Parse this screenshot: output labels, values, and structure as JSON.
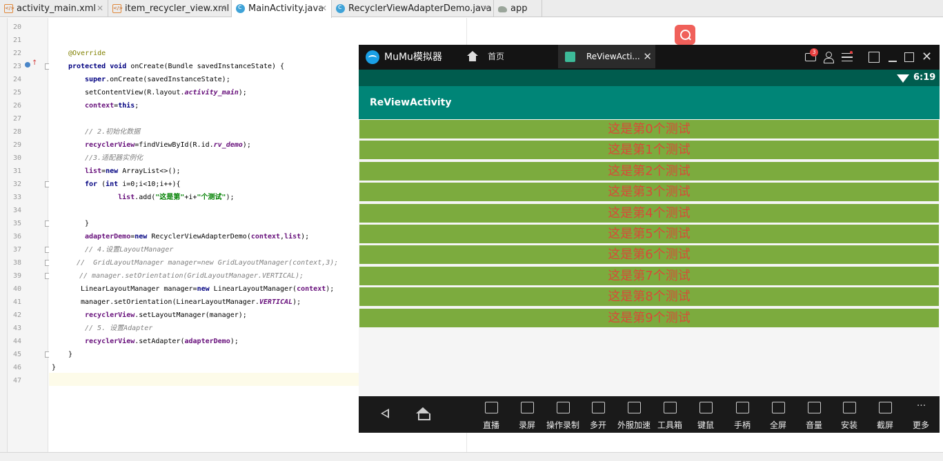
{
  "tabs": [
    {
      "label": "activity_main.xml",
      "icon": "xml-file-icon",
      "active": false
    },
    {
      "label": "item_recycler_view.xml",
      "icon": "xml-file-icon",
      "active": false
    },
    {
      "label": "MainActivity.java",
      "icon": "java-class-icon",
      "active": true
    },
    {
      "label": "RecyclerViewAdapterDemo.java",
      "icon": "java-class-icon",
      "active": false
    },
    {
      "label": "app",
      "icon": "gradle-icon",
      "active": false
    }
  ],
  "editor": {
    "line_numbers": [
      "20",
      "21",
      "22",
      "23",
      "24",
      "25",
      "26",
      "27",
      "28",
      "29",
      "30",
      "31",
      "32",
      "33",
      "34",
      "35",
      "36",
      "37",
      "38",
      "39",
      "40",
      "41",
      "42",
      "43",
      "44",
      "45",
      "46",
      "47"
    ],
    "code_lines": [
      [],
      [],
      [
        {
          "t": "@Override",
          "c": "an"
        }
      ],
      [
        {
          "t": "protected void ",
          "c": "kw"
        },
        {
          "t": "onCreate(Bundle savedInstanceState) {",
          "c": ""
        }
      ],
      [
        {
          "t": "super",
          "c": "kw"
        },
        {
          "t": ".onCreate(savedInstanceState);",
          "c": ""
        }
      ],
      [
        {
          "t": "setContentView(R.layout.",
          "c": ""
        },
        {
          "t": "activity_main",
          "c": "fi"
        },
        {
          "t": ");",
          "c": ""
        }
      ],
      [
        {
          "t": "context",
          "c": "fld"
        },
        {
          "t": "=",
          "c": ""
        },
        {
          "t": "this",
          "c": "kw"
        },
        {
          "t": ";",
          "c": ""
        }
      ],
      [],
      [
        {
          "t": "// 2.初始化数据",
          "c": "cm"
        }
      ],
      [
        {
          "t": "recyclerView",
          "c": "fld"
        },
        {
          "t": "=findViewById(R.id.",
          "c": ""
        },
        {
          "t": "rv_demo",
          "c": "fi"
        },
        {
          "t": ");",
          "c": ""
        }
      ],
      [
        {
          "t": "//3.适配器实例化",
          "c": "cm"
        }
      ],
      [
        {
          "t": "list",
          "c": "fld"
        },
        {
          "t": "=",
          "c": ""
        },
        {
          "t": "new ",
          "c": "kw"
        },
        {
          "t": "ArrayList<>();",
          "c": ""
        }
      ],
      [
        {
          "t": "for ",
          "c": "kw"
        },
        {
          "t": "(",
          "c": ""
        },
        {
          "t": "int ",
          "c": "kw"
        },
        {
          "t": "i=0;i<10;i++){",
          "c": ""
        }
      ],
      [
        {
          "t": "    list",
          "c": "fld"
        },
        {
          "t": ".add(",
          "c": ""
        },
        {
          "t": "\"这是第\"",
          "c": "st"
        },
        {
          "t": "+i+",
          "c": ""
        },
        {
          "t": "\"个测试\"",
          "c": "st"
        },
        {
          "t": ");",
          "c": ""
        }
      ],
      [],
      [
        {
          "t": "}",
          "c": ""
        }
      ],
      [
        {
          "t": "adapterDemo",
          "c": "fld"
        },
        {
          "t": "=",
          "c": ""
        },
        {
          "t": "new ",
          "c": "kw"
        },
        {
          "t": "RecyclerViewAdapterDemo(",
          "c": ""
        },
        {
          "t": "context",
          "c": "fld"
        },
        {
          "t": ",",
          "c": ""
        },
        {
          "t": "list",
          "c": "fld"
        },
        {
          "t": ");",
          "c": ""
        }
      ],
      [
        {
          "t": "// 4.设置LayoutManager",
          "c": "cm"
        }
      ],
      [
        {
          "t": "//  GridLayoutManager manager=new GridLayoutManager(context,3);",
          "c": "cm"
        }
      ],
      [
        {
          "t": "// manager.setOrientation(GridLayoutManager.VERTICAL);",
          "c": "cm"
        }
      ],
      [
        {
          "t": "LinearLayoutManager manager=",
          "c": ""
        },
        {
          "t": "new ",
          "c": "kw"
        },
        {
          "t": "LinearLayoutManager(",
          "c": ""
        },
        {
          "t": "context",
          "c": "fld"
        },
        {
          "t": ");",
          "c": ""
        }
      ],
      [
        {
          "t": "manager.setOrientation(LinearLayoutManager.",
          "c": ""
        },
        {
          "t": "VERTICAL",
          "c": "fi"
        },
        {
          "t": ");",
          "c": ""
        }
      ],
      [
        {
          "t": "recyclerView",
          "c": "fld"
        },
        {
          "t": ".setLayoutManager(manager);",
          "c": ""
        }
      ],
      [
        {
          "t": "// 5. 设置Adapter",
          "c": "cm"
        }
      ],
      [
        {
          "t": "recyclerView",
          "c": "fld"
        },
        {
          "t": ".setAdapter(",
          "c": ""
        },
        {
          "t": "adapterDemo",
          "c": "fld"
        },
        {
          "t": ");",
          "c": ""
        }
      ],
      [
        {
          "t": "}",
          "c": ""
        }
      ],
      [
        {
          "t": "}",
          "c": ""
        }
      ],
      []
    ]
  },
  "emulator": {
    "name": "MuMu模拟器",
    "home_tab": "首页",
    "app_tab": "ReViewActi...",
    "mail_badge": "3",
    "clock": "6:19",
    "appbar_title": "ReViewActivity",
    "items": [
      "这是第0个测试",
      "这是第1个测试",
      "这是第2个测试",
      "这是第3个测试",
      "这是第4个测试",
      "这是第5个测试",
      "这是第6个测试",
      "这是第7个测试",
      "这是第8个测试",
      "这是第9个测试"
    ],
    "tools": [
      {
        "label": "直播",
        "icon": "live-icon"
      },
      {
        "label": "录屏",
        "icon": "record-screen-icon"
      },
      {
        "label": "操作录制",
        "icon": "macro-record-icon"
      },
      {
        "label": "多开",
        "icon": "multi-instance-icon"
      },
      {
        "label": "外服加速",
        "icon": "accelerate-icon"
      },
      {
        "label": "工具箱",
        "icon": "toolbox-icon"
      },
      {
        "label": "键鼠",
        "icon": "keyboard-icon"
      },
      {
        "label": "手柄",
        "icon": "gamepad-icon"
      },
      {
        "label": "全屏",
        "icon": "fullscreen-icon"
      },
      {
        "label": "音量",
        "icon": "volume-icon"
      },
      {
        "label": "安装",
        "icon": "apk-install-icon"
      },
      {
        "label": "截屏",
        "icon": "screenshot-icon"
      },
      {
        "label": "更多",
        "icon": "more-icon"
      }
    ]
  },
  "colors": {
    "item_bg": "#7cab3e",
    "item_text": "#d94a38",
    "appbar": "#008577",
    "statusbar": "#005c4e"
  }
}
